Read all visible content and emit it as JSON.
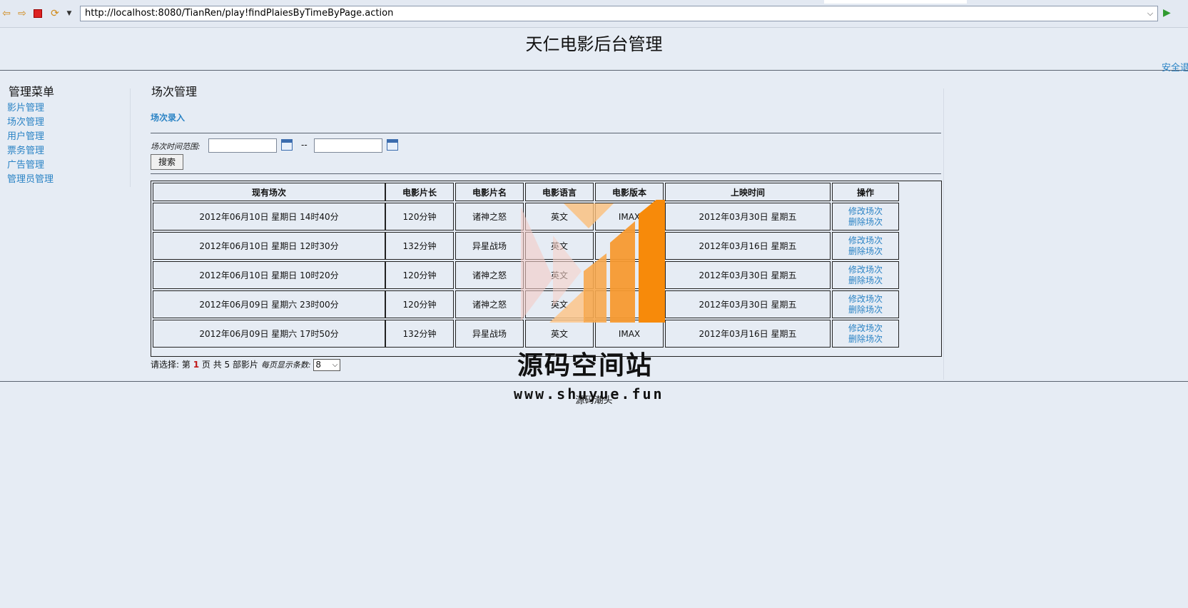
{
  "browser": {
    "url": "http://localhost:8080/TianRen/play!findPlaiesByTimeByPage.action"
  },
  "header": {
    "title": "天仁电影后台管理",
    "logout": "安全退"
  },
  "sidebar": {
    "title": "管理菜单",
    "items": [
      "影片管理",
      "场次管理",
      "用户管理",
      "票务管理",
      "广告管理",
      "管理员管理"
    ]
  },
  "main": {
    "title": "场次管理",
    "add_link": "场次录入",
    "range_label": "场次时间范围:",
    "range_separator": "--",
    "search_button": "搜索",
    "table": {
      "headers": [
        "现有场次",
        "电影片长",
        "电影片名",
        "电影语言",
        "电影版本",
        "上映时间",
        "操作"
      ],
      "rows": [
        [
          "2012年06月10日 星期日 14时40分",
          "120分钟",
          "诸神之怒",
          "英文",
          "IMAX",
          "2012年03月30日 星期五"
        ],
        [
          "2012年06月10日 星期日 12时30分",
          "132分钟",
          "异星战场",
          "英文",
          "",
          "2012年03月16日 星期五"
        ],
        [
          "2012年06月10日 星期日 10时20分",
          "120分钟",
          "诸神之怒",
          "英文",
          "",
          "2012年03月30日 星期五"
        ],
        [
          "2012年06月09日 星期六 23时00分",
          "120分钟",
          "诸神之怒",
          "英文",
          "",
          "2012年03月30日 星期五"
        ],
        [
          "2012年06月09日 星期六 17时50分",
          "132分钟",
          "异星战场",
          "英文",
          "IMAX",
          "2012年03月16日 星期五"
        ]
      ],
      "op_edit": "修改场次",
      "op_delete": "删除场次"
    },
    "pager": {
      "prefix": "请选择: 第",
      "current_page": "1",
      "middle": "页 共",
      "total": "5",
      "suffix": "部影片",
      "per_page_label": "每页显示条数:",
      "per_page_value": "8"
    }
  },
  "footer": {
    "text": "源码潮头"
  },
  "watermark": {
    "title": "源码空间站",
    "url": "www.shuyue.fun"
  },
  "colors": {
    "background": "#e6ecf4",
    "link": "#2a83c5",
    "current_page": "#c01818",
    "watermark_orange": "#f7931e"
  }
}
